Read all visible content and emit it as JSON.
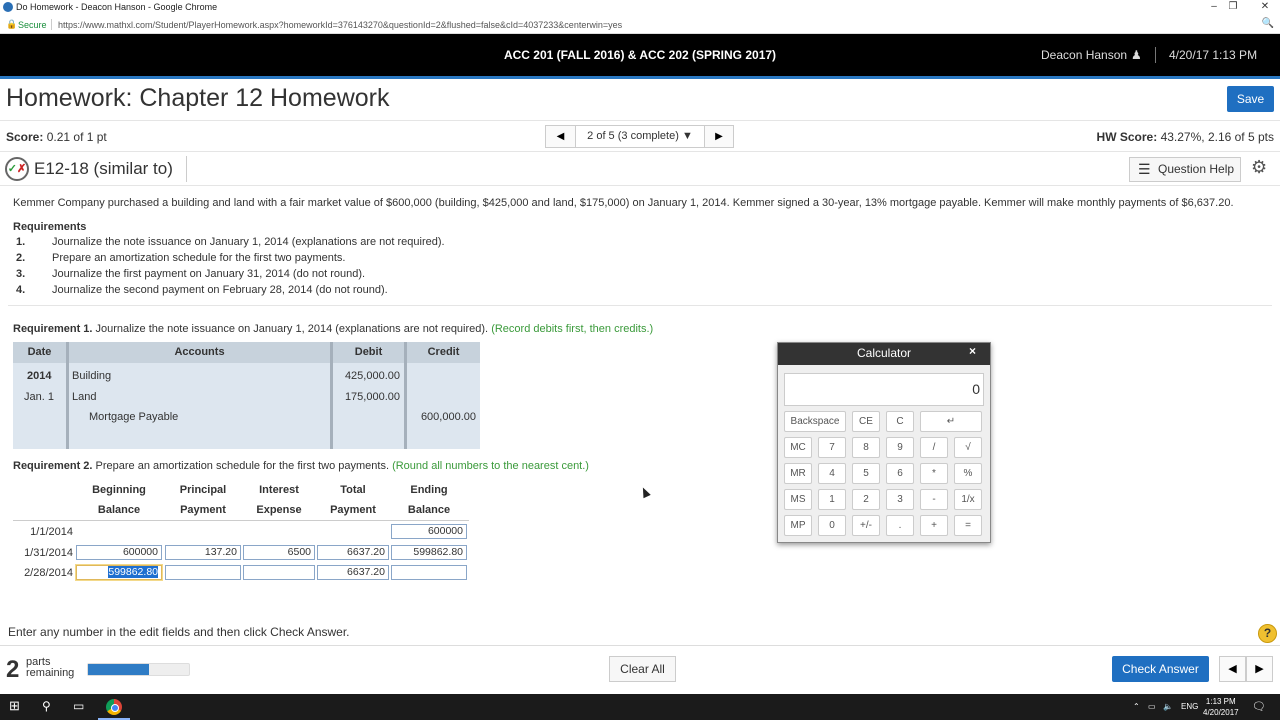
{
  "browser": {
    "tab_title": "Do Homework - Deacon Hanson - Google Chrome",
    "secure_label": "Secure",
    "url": "https://www.mathxl.com/Student/PlayerHomework.aspx?homeworkId=376143270&questionId=2&flushed=false&cId=4037233&centerwin=yes",
    "minimize": "–",
    "restore": "❐",
    "close": "✕",
    "zoom_icon": "🔍"
  },
  "header": {
    "course": "ACC 201 (FALL 2016) & ACC 202 (SPRING 2017)",
    "user": "Deacon Hanson",
    "datetime": "4/20/17 1:13 PM"
  },
  "homework": {
    "title": "Homework: Chapter 12 Homework",
    "save_label": "Save",
    "score_label": "Score:",
    "score_value": "0.21 of 1 pt",
    "question_selector": "2 of 5 (3 complete)",
    "prev": "◀",
    "next": "▶",
    "hw_score_label": "HW Score:",
    "hw_score_value": "43.27%, 2.16 of 5 pts"
  },
  "question": {
    "title": "E12-18 (similar to)",
    "help_label": "Question Help",
    "intro": "Kemmer Company purchased a building and land with a fair market value of $600,000 (building, $425,000 and land, $175,000) on January 1, 2014. Kemmer signed a 30-year, 13% mortgage payable. Kemmer will make monthly payments of $6,637.20.",
    "requirements_title": "Requirements",
    "requirements": [
      {
        "num": "1.",
        "text": "Journalize the note issuance on January 1, 2014 (explanations are not required)."
      },
      {
        "num": "2.",
        "text": "Prepare an amortization schedule for the first two payments."
      },
      {
        "num": "3.",
        "text": "Journalize the first payment on January 31, 2014 (do not round)."
      },
      {
        "num": "4.",
        "text": "Journalize the second payment on February 28, 2014 (do not round)."
      }
    ]
  },
  "req1": {
    "label": "Requirement 1.",
    "text": "Journalize the note issuance on January 1, 2014 (explanations are not required).",
    "hint": "(Record debits first, then credits.)",
    "headers": {
      "date": "Date",
      "accounts": "Accounts",
      "debit": "Debit",
      "credit": "Credit"
    },
    "year": "2014",
    "date": "Jan. 1",
    "rows": [
      {
        "account": "Building",
        "debit": "425,000.00",
        "credit": ""
      },
      {
        "account": "Land",
        "debit": "175,000.00",
        "credit": ""
      },
      {
        "account": "Mortgage Payable",
        "debit": "",
        "credit": "600,000.00"
      }
    ]
  },
  "req2": {
    "label": "Requirement 2.",
    "text": "Prepare an amortization schedule for the first two payments.",
    "hint": "(Round all numbers to the nearest cent.)",
    "headers": [
      {
        "l1": "Beginning",
        "l2": "Balance"
      },
      {
        "l1": "Principal",
        "l2": "Payment"
      },
      {
        "l1": "Interest",
        "l2": "Expense"
      },
      {
        "l1": "Total",
        "l2": "Payment"
      },
      {
        "l1": "Ending",
        "l2": "Balance"
      }
    ],
    "rows": [
      {
        "date": "1/1/2014",
        "ending": "600000"
      },
      {
        "date": "1/31/2014",
        "beginning": "600000",
        "principal": "137.20",
        "interest": "6500",
        "total": "6637.20",
        "ending": "599862.80"
      },
      {
        "date": "2/28/2014",
        "beginning": "599862.80",
        "principal": "",
        "interest": "",
        "total": "6637.20",
        "ending": ""
      }
    ]
  },
  "calculator": {
    "title": "Calculator",
    "close": "×",
    "display": "0",
    "keys": {
      "backspace": "Backspace",
      "ce": "CE",
      "c": "C",
      "enter": "↵",
      "mc": "MC",
      "k7": "7",
      "k8": "8",
      "k9": "9",
      "div": "/",
      "sqrt": "√",
      "mr": "MR",
      "k4": "4",
      "k5": "5",
      "k6": "6",
      "mul": "*",
      "pct": "%",
      "ms": "MS",
      "k1": "1",
      "k2": "2",
      "k3": "3",
      "sub": "-",
      "inv": "1/x",
      "mp": "MP",
      "k0": "0",
      "neg": "+/-",
      "dot": ".",
      "add": "+",
      "eq": "="
    }
  },
  "footer": {
    "instruction": "Enter any number in the edit fields and then click Check Answer.",
    "help_q": "?",
    "parts_count": "2",
    "parts_label_1": "parts",
    "parts_label_2": "remaining",
    "progress_fraction": 0.6,
    "clear_all": "Clear All",
    "check_answer": "Check Answer"
  },
  "taskbar": {
    "lang": "ENG",
    "time": "1:13 PM",
    "date": "4/20/2017"
  }
}
